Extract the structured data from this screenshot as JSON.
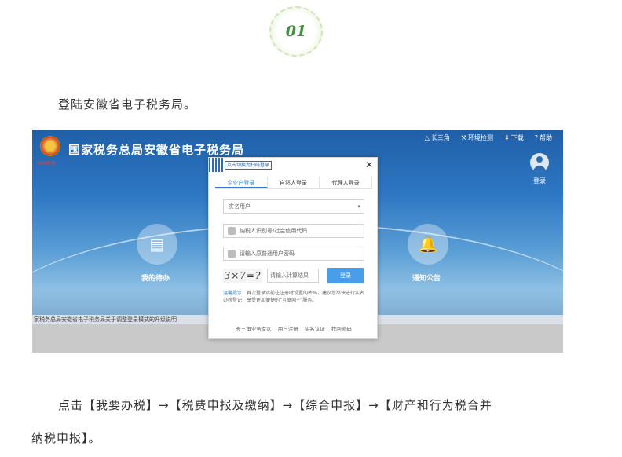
{
  "step_badge": "01",
  "text": {
    "p1": "登陆安徽省电子税务局。",
    "p2": "点击【我要办税】→【税费申报及缴纳】→【综合申报】→【财产和行为税合并",
    "p3": "纳税申报】。"
  },
  "site": {
    "emblem_caption": "中国税务",
    "title": "国家税务总局安徽省电子税务局",
    "top_links": [
      {
        "icon": "triangle-icon",
        "glyph": "△",
        "label": "长三角"
      },
      {
        "icon": "wrench-icon",
        "glyph": "⚒",
        "label": "环境检测"
      },
      {
        "icon": "download-icon",
        "glyph": "⇓",
        "label": "下载"
      },
      {
        "icon": "help-icon",
        "glyph": "?",
        "label": "帮助"
      }
    ],
    "login_label": "登录",
    "todo_label": "我的待办",
    "notice_label": "通知公告",
    "notice_bar": "家税务总局安徽省电子税务局关于调整登录模式的升级说明"
  },
  "modal": {
    "qr_tip": "点击切换为扫码登录",
    "close": "✕",
    "tabs": [
      "企业户登录",
      "自然人登录",
      "代理人登录"
    ],
    "select_value": "实名用户",
    "tax_placeholder": "纳税人识别号/社会信用代码",
    "password_placeholder": "请输入原普通用户密码",
    "captcha_text": "3×7=?",
    "captcha_placeholder": "请输入计算结果",
    "login_button": "登录",
    "warm_label": "温馨提示：",
    "warm_text": "首次登录请前往注册时设置的密码，建议您尽快进行实名办税登记，享受更加便捷的“互联网+”服务。",
    "footer_links": [
      "长三角业务专区",
      "用户注册",
      "实名认证",
      "找回密码"
    ]
  }
}
